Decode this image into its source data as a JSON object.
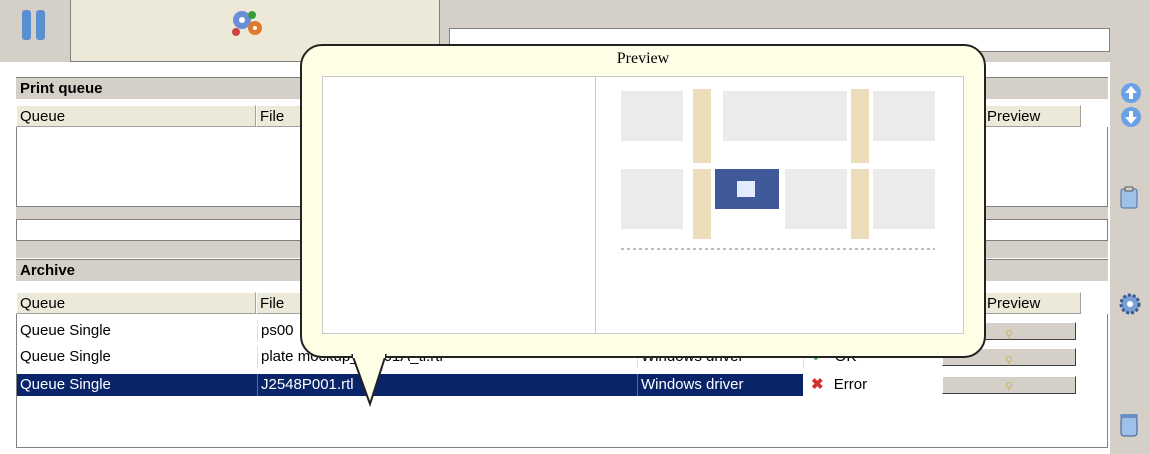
{
  "print_queue": {
    "title": "Print queue",
    "columns": [
      "Queue",
      "File",
      "Preview"
    ]
  },
  "archive": {
    "title": "Archive",
    "columns": [
      "Queue",
      "File",
      "Preview"
    ],
    "rows": [
      {
        "queue": "Queue Single",
        "file": "ps00",
        "driver": "",
        "status": ""
      },
      {
        "queue": "Queue Single",
        "file": "plate mockup_f_6 01A_tl.rtl",
        "driver": "Windows driver",
        "status": "OK"
      },
      {
        "queue": "Queue Single",
        "file": "J2548P001.rtl",
        "driver": "Windows driver",
        "status": "Error"
      }
    ]
  },
  "preview_popup": {
    "title": "Preview"
  },
  "colors": {
    "selection": "#0a246a",
    "ok": "#4caf50",
    "error": "#d03030"
  },
  "icons": [
    "pause-icon",
    "gear-logo-icon",
    "arrow-up-icon",
    "arrow-down-icon",
    "clipboard-icon",
    "settings-gear-icon",
    "trash-icon",
    "magnifier-icon"
  ]
}
